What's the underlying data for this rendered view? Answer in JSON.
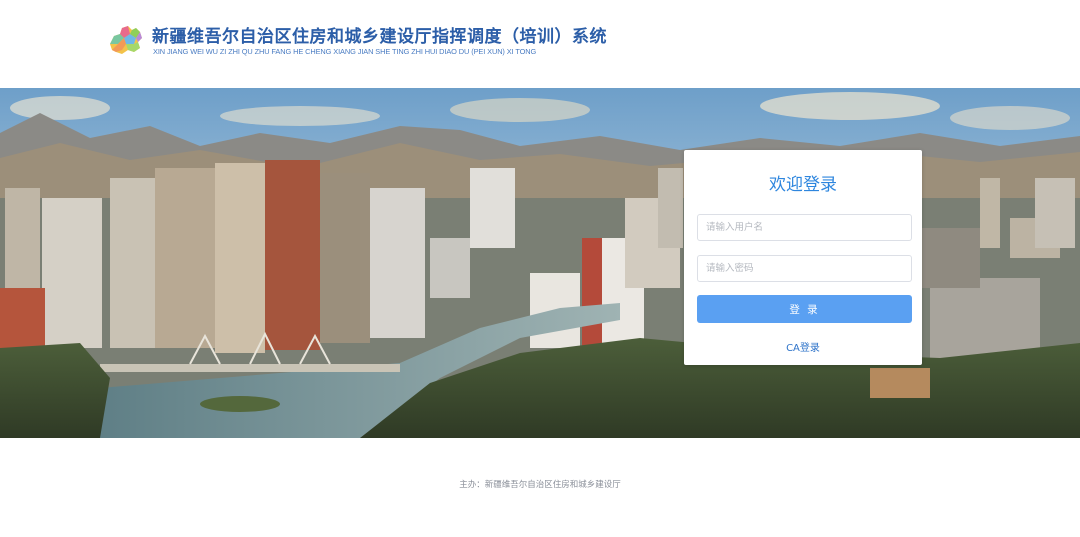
{
  "header": {
    "title": "新疆维吾尔自治区住房和城乡建设厅指挥调度（培训）系统",
    "subtitle": "XIN JIANG WEI WU ZI ZHI QU ZHU FANG HE CHENG XIANG JIAN SHE TING ZHI HUI DIAO DU (PEI XUN) XI TONG",
    "logo_icon": "xinjiang-map-icon"
  },
  "banner": {
    "image_icon": "city-skyline-photo"
  },
  "login": {
    "title": "欢迎登录",
    "username_placeholder": "请输入用户名",
    "username_value": "",
    "password_placeholder": "请输入密码",
    "password_value": "",
    "login_button": "登 录",
    "ca_link": "CA登录"
  },
  "footer": {
    "text": "主办：新疆维吾尔自治区住房和城乡建设厅"
  },
  "colors": {
    "title_blue": "#2c5ea8",
    "accent_blue": "#2e86de",
    "button_blue": "#5aa0f2"
  }
}
